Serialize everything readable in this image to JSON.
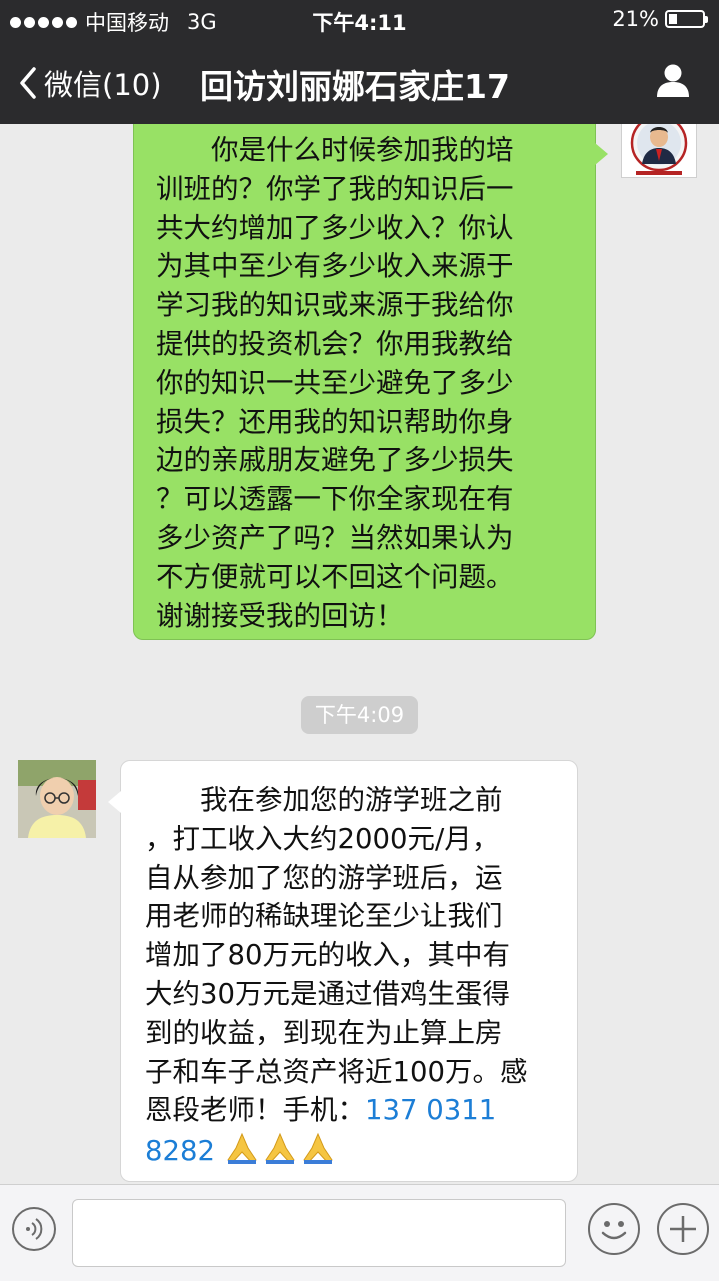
{
  "status_bar": {
    "carrier": "中国移动",
    "network": "3G",
    "time": "下午4:11",
    "battery_text": "21%",
    "battery_level": 0.21,
    "signal_icon": "signal-dots-icon",
    "battery_icon": "battery-icon"
  },
  "nav": {
    "back_label": "微信(10)",
    "title": "回访刘丽娜石家庄17",
    "back_icon": "chevron-left-icon",
    "profile_icon": "person-icon"
  },
  "messages": {
    "outgoing": {
      "lines": [
        "　　你是什么时候参加我的培",
        "训班的？你学了我的知识后一",
        "共大约增加了多少收入？你认",
        "为其中至少有多少收入来源于",
        "学习我的知识或来源于我给你",
        "提供的投资机会？你用我教给",
        "你的知识一共至少避免了多少",
        "损失？还用我的知识帮助你身",
        "边的亲戚朋友避免了多少损失",
        "？可以透露一下你全家现在有",
        "多少资产了吗？当然如果认为",
        "不方便就可以不回这个问题。",
        "谢谢接受我的回访！"
      ],
      "bubble_color": "#98e165"
    },
    "timestamp": "下午4:09",
    "incoming": {
      "lines": [
        "　　我在参加您的游学班之前",
        "，打工收入大约2000元/月，",
        "自从参加了您的游学班后，运",
        "用老师的稀缺理论至少让我们",
        "增加了80万元的收入，其中有",
        "大约30万元是通过借鸡生蛋得",
        "到的收益，到现在为止算上房",
        "子和车子总资产将近100万。感"
      ],
      "line9_prefix": "恩段老师！手机：",
      "phone_part1": "137 0311",
      "phone_part2": "8282",
      "emoji_icon": "folded-hands-icon",
      "link_color": "#1c7ed6"
    }
  },
  "input_bar": {
    "voice_icon": "voice-icon",
    "emoji_icon": "smiley-icon",
    "more_icon": "plus-icon"
  }
}
